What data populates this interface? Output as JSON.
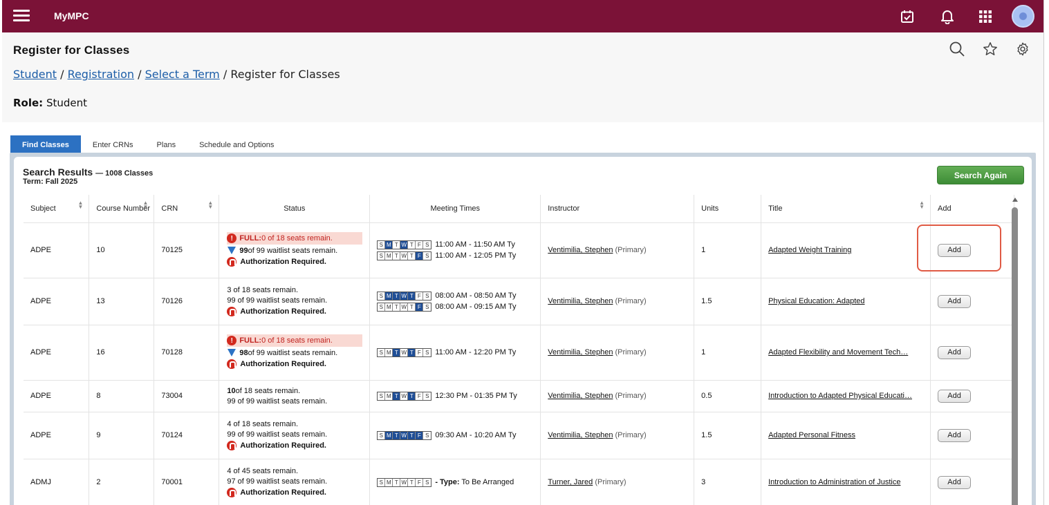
{
  "app": {
    "brand": "MyMPC"
  },
  "colors": {
    "topbar": "#7b1237",
    "accent_tab": "#2c71c2",
    "search_again": "#4a9a40",
    "full_red": "#c0221f"
  },
  "header": {
    "title": "Register for Classes",
    "breadcrumb": [
      "Student",
      "Registration",
      "Select a Term"
    ],
    "breadcrumb_current": "Register for Classes",
    "breadcrumb_sep": "/",
    "role_label": "Role:",
    "role_value": "Student"
  },
  "tabs": [
    {
      "label": "Find Classes",
      "active": true
    },
    {
      "label": "Enter CRNs",
      "active": false
    },
    {
      "label": "Plans",
      "active": false
    },
    {
      "label": "Schedule and Options",
      "active": false
    }
  ],
  "results": {
    "title": "Search Results",
    "count": "— 1008 Classes",
    "term": "Term: Fall 2025",
    "search_again_label": "Search Again",
    "columns": [
      "Subject",
      "Course Number",
      "CRN",
      "Status",
      "Meeting Times",
      "Instructor",
      "Units",
      "Title",
      "Add"
    ],
    "rows": [
      {
        "subject": "ADPE",
        "course": "10",
        "crn": "70125",
        "full": "FULL: 0 of 18 seats remain.",
        "full_prefix": "FULL:",
        "full_rest": " 0 of 18 seats remain.",
        "seats": "",
        "wait_num": "99",
        "wait_rest": " of 99 waitlist seats remain.",
        "wait_icon": true,
        "auth": "Authorization Required.",
        "meetings": [
          {
            "days": [
              0,
              1,
              0,
              1,
              0,
              0,
              0
            ],
            "time": "11:00 AM - 11:50 AM Ty"
          },
          {
            "days": [
              0,
              0,
              0,
              0,
              0,
              1,
              0
            ],
            "time": "11:00 AM - 12:05 PM Ty"
          }
        ],
        "instructor": "Ventimilia, Stephen",
        "role": " (Primary)",
        "units": "1",
        "title": "Adapted Weight Training",
        "add": "Add"
      },
      {
        "subject": "ADPE",
        "course": "13",
        "crn": "70126",
        "full": "",
        "seats": "3 of 18 seats remain.",
        "wait_num": "",
        "wait_rest": "99 of 99 waitlist seats remain.",
        "wait_icon": false,
        "auth": "Authorization Required.",
        "meetings": [
          {
            "days": [
              0,
              1,
              1,
              1,
              1,
              0,
              0
            ],
            "time": "08:00 AM - 08:50 AM Ty"
          },
          {
            "days": [
              0,
              0,
              0,
              0,
              0,
              1,
              0
            ],
            "time": "08:00 AM - 09:15 AM Ty"
          }
        ],
        "instructor": "Ventimilia, Stephen",
        "role": " (Primary)",
        "units": "1.5",
        "title": "Physical Education: Adapted",
        "add": "Add"
      },
      {
        "subject": "ADPE",
        "course": "16",
        "crn": "70128",
        "full": "FULL: 0 of 18 seats remain.",
        "full_prefix": "FULL:",
        "full_rest": " 0 of 18 seats remain.",
        "seats": "",
        "wait_num": "98",
        "wait_rest": " of 99 waitlist seats remain.",
        "wait_icon": true,
        "auth": "Authorization Required.",
        "meetings": [
          {
            "days": [
              0,
              0,
              1,
              0,
              1,
              0,
              0
            ],
            "time": "11:00 AM - 12:20 PM Ty"
          }
        ],
        "instructor": "Ventimilia, Stephen",
        "role": " (Primary)",
        "units": "1",
        "title": "Adapted Flexibility and Movement Tech…",
        "add": "Add"
      },
      {
        "subject": "ADPE",
        "course": "8",
        "crn": "73004",
        "full": "",
        "seats_num": "10",
        "seats": " of 18 seats remain.",
        "wait_num": "",
        "wait_rest": "99 of 99 waitlist seats remain.",
        "wait_icon": false,
        "auth": "",
        "meetings": [
          {
            "days": [
              0,
              0,
              1,
              0,
              1,
              0,
              0
            ],
            "time": "12:30 PM - 01:35 PM Ty"
          }
        ],
        "instructor": "Ventimilia, Stephen",
        "role": " (Primary)",
        "units": "0.5",
        "title": "Introduction to Adapted Physical Educati…",
        "add": "Add"
      },
      {
        "subject": "ADPE",
        "course": "9",
        "crn": "70124",
        "full": "",
        "seats": "4 of 18 seats remain.",
        "wait_num": "",
        "wait_rest": "99 of 99 waitlist seats remain.",
        "wait_icon": false,
        "auth": "Authorization Required.",
        "meetings": [
          {
            "days": [
              0,
              1,
              1,
              1,
              1,
              1,
              0
            ],
            "time": "09:30 AM - 10:20 AM Ty"
          }
        ],
        "instructor": "Ventimilia, Stephen",
        "role": " (Primary)",
        "units": "1.5",
        "title": "Adapted Personal Fitness",
        "add": "Add"
      },
      {
        "subject": "ADMJ",
        "course": "2",
        "crn": "70001",
        "full": "",
        "seats": "4 of 45 seats remain.",
        "wait_num": "",
        "wait_rest": "97 of 99 waitlist seats remain.",
        "wait_icon": false,
        "auth": "Authorization Required.",
        "meetings": [
          {
            "days": [
              0,
              0,
              0,
              0,
              0,
              0,
              0
            ],
            "time": "",
            "type_label": "- Type:",
            "type_value": " To Be Arranged"
          }
        ],
        "instructor": "Turner, Jared",
        "role": " (Primary)",
        "units": "3",
        "title": "Introduction to Administration of Justice",
        "add": "Add"
      }
    ]
  },
  "day_letters": [
    "S",
    "M",
    "T",
    "W",
    "T",
    "F",
    "S"
  ],
  "icons": {
    "menu": "hamburger-icon",
    "calendar": "calendar-check-icon",
    "bell": "bell-icon",
    "apps": "apps-grid-icon",
    "search": "search-icon",
    "star": "star-icon",
    "settings": "gear-icon"
  }
}
